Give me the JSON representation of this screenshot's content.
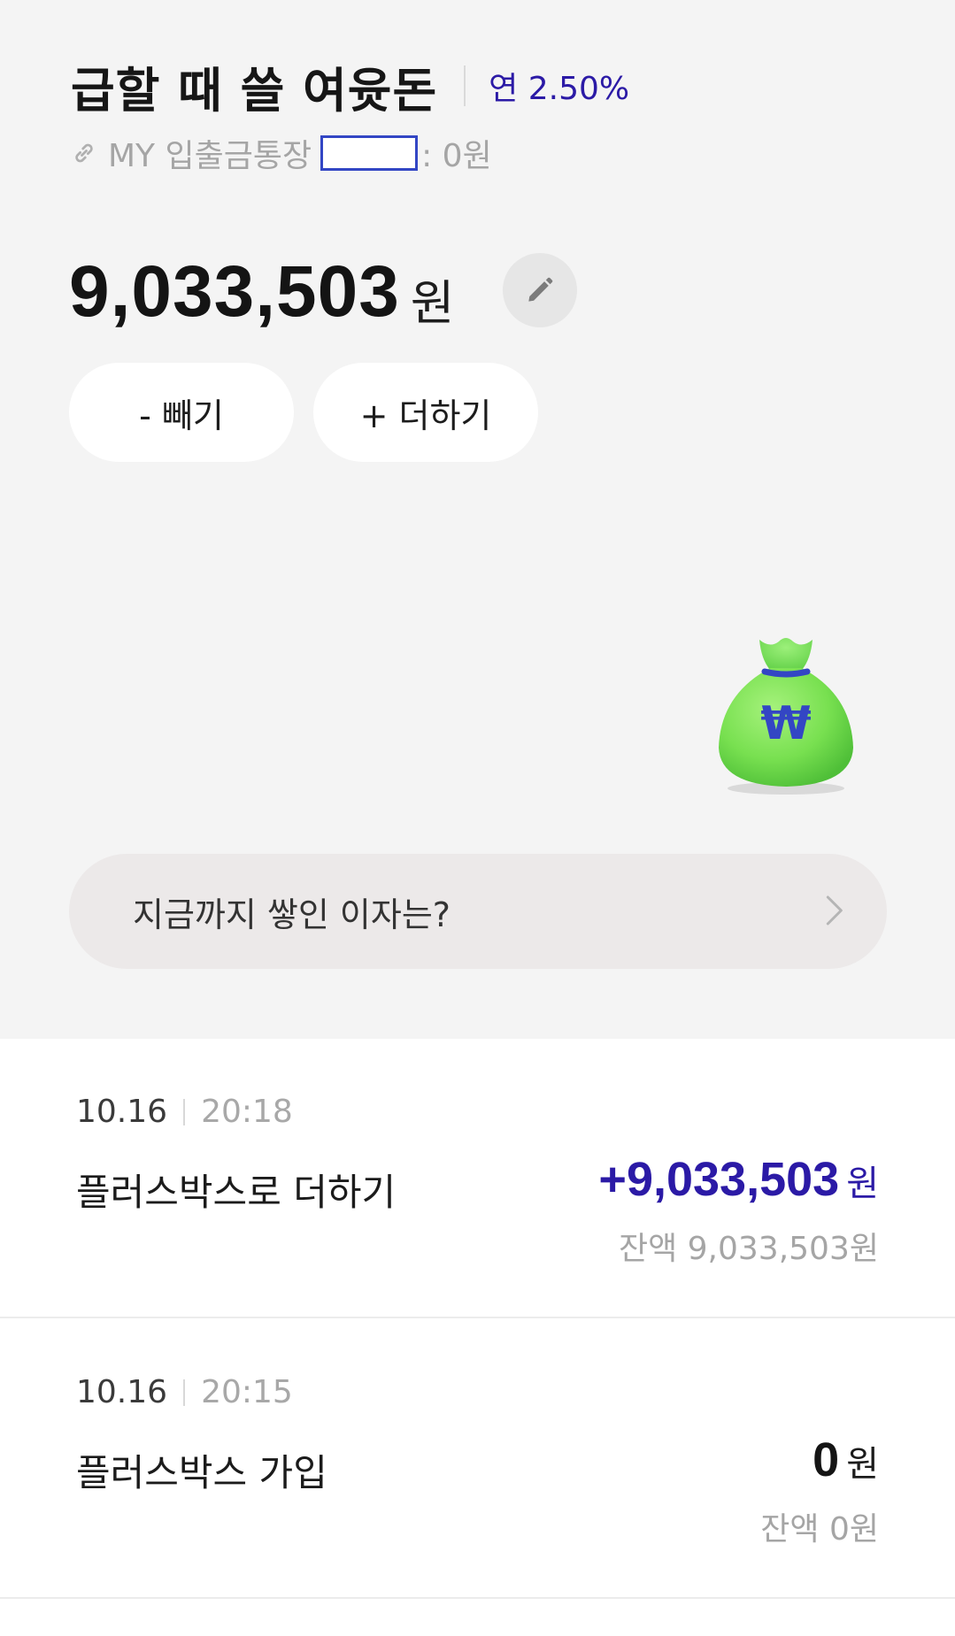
{
  "header": {
    "title": "급할 때 쓸 여윳돈",
    "rate": "연 2.50%"
  },
  "linked_account": {
    "label": "MY 입출금통장",
    "suffix": ": 0원"
  },
  "balance": {
    "amount": "9,033,503",
    "unit": "원"
  },
  "actions": {
    "minus_label": "- 빼기",
    "plus_label": "+ 더하기"
  },
  "interest": {
    "label": "지금까지 쌓인 이자는?"
  },
  "transactions": [
    {
      "date": "10.16",
      "time": "20:18",
      "description": "플러스박스로 더하기",
      "amount": "+9,033,503",
      "unit": "원",
      "balance": "잔액 9,033,503원"
    },
    {
      "date": "10.16",
      "time": "20:15",
      "description": "플러스박스 가입",
      "amount": "0",
      "unit": "원",
      "balance": "잔액 0원"
    }
  ],
  "icons": {
    "link": "link-icon",
    "edit": "pencil-icon",
    "bag": "money-bag-won-icon",
    "chevron": "chevron-right-icon"
  },
  "colors": {
    "accent": "#2b1aa6",
    "bag_green": "#7ee35a",
    "bag_won": "#3346c4"
  }
}
